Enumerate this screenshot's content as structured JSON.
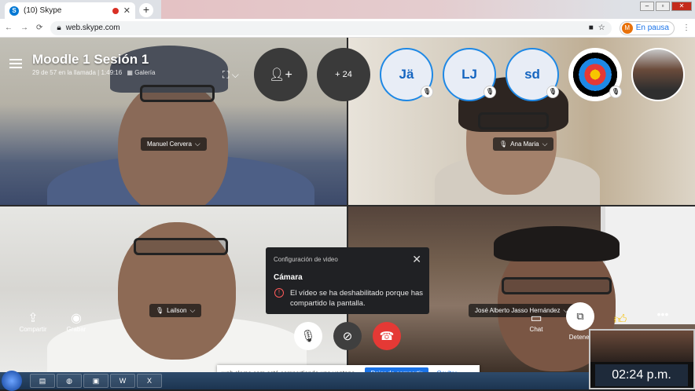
{
  "browser": {
    "tab_title": "(10) Skype",
    "tab_logo": "S",
    "url": "web.skype.com",
    "profile_initial": "M",
    "profile_status": "En pausa"
  },
  "call": {
    "title": "Moodle 1 Sesión 1",
    "subtitle": "29 de 57 en la llamada | 1:49:16",
    "view_mode": "Galería",
    "more_participants": "+ 24",
    "avatars": [
      {
        "initials": "Jä"
      },
      {
        "initials": "LJ"
      },
      {
        "initials": "sd"
      }
    ]
  },
  "participants": [
    {
      "name": "Manuel Cervera"
    },
    {
      "name": "Ana Maria"
    },
    {
      "name": "Lailson"
    },
    {
      "name": "José Alberto Jasso Hernández"
    }
  ],
  "toast": {
    "header": "Configuración de video",
    "title": "Cámara",
    "message": "El vídeo se ha deshabilitado porque has compartido la pantalla."
  },
  "controls": {
    "share": "Compartir",
    "record": "Grabar",
    "chat": "Chat",
    "stop": "Detener"
  },
  "sharebar": {
    "message": "web.skype.com está compartiendo una ventana.",
    "stop_label": "Dejar de compartir",
    "hide_label": "Ocultar"
  },
  "taskbar": {
    "clock": "02:24 p.m."
  },
  "colors": {
    "skype_blue": "#0078d4",
    "hangup_red": "#e53935",
    "avatar_border": "#1e88e5"
  }
}
